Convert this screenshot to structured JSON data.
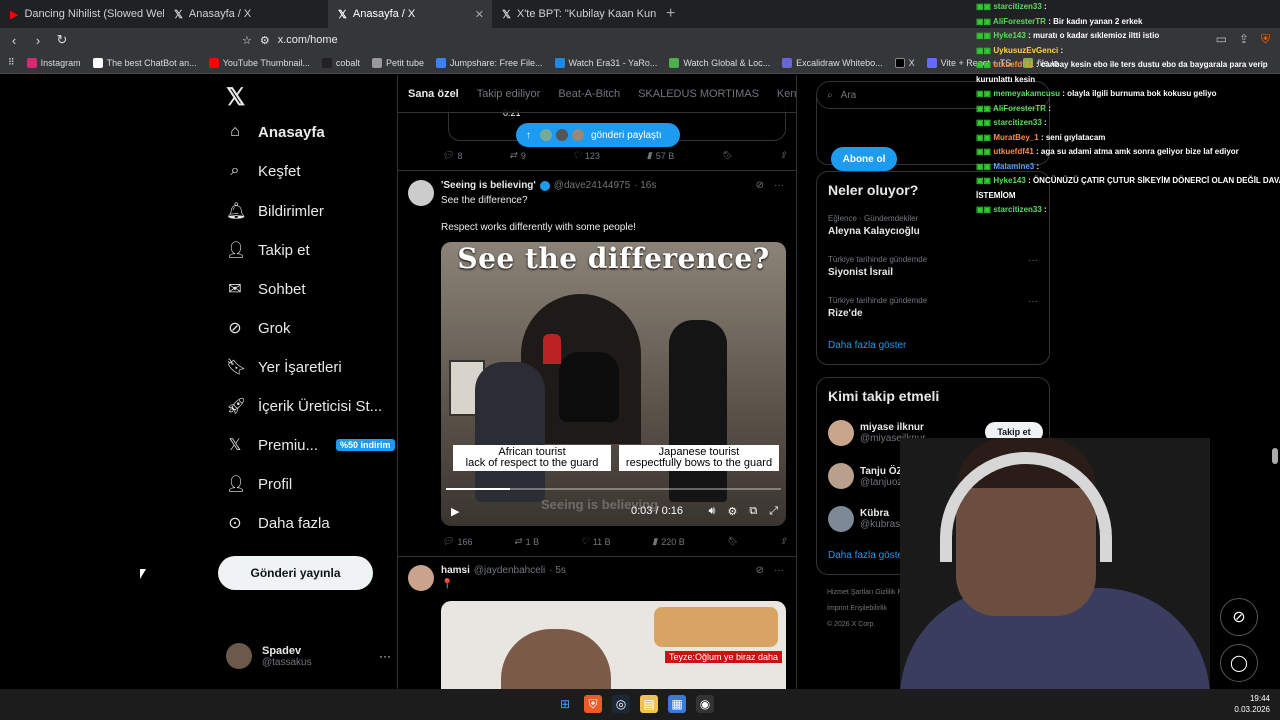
{
  "browser": {
    "tabs": [
      {
        "label": "Dancing Nihilist (Slowed Welly W",
        "active": false
      },
      {
        "label": "Anasayfa / X",
        "active": false
      },
      {
        "label": "Anasayfa / X",
        "active": true
      },
      {
        "label": "X'te BPT: \"Kubilay Kaan Kundakçı'nın",
        "active": false
      }
    ],
    "url": "x.com/home",
    "bookmarks": [
      "Instagram",
      "The best ChatBot an...",
      "YouTube Thumbnail...",
      "cobalt",
      "Petit tube",
      "Jumpshare: Free File...",
      "Watch Era31 - YaRo...",
      "Watch Global & Loc...",
      "Excalidraw Whitebo...",
      "X",
      "Vite + React + TS",
      "file.io"
    ],
    "bookmarks_trailing": "İşaretleri"
  },
  "nav": {
    "items": [
      {
        "label": "Anasayfa",
        "icon": "home-icon",
        "active": true
      },
      {
        "label": "Keşfet",
        "icon": "search-icon"
      },
      {
        "label": "Bildirimler",
        "icon": "bell-icon"
      },
      {
        "label": "Takip et",
        "icon": "person-add-icon"
      },
      {
        "label": "Sohbet",
        "icon": "mail-icon"
      },
      {
        "label": "Grok",
        "icon": "grok-icon"
      },
      {
        "label": "Yer İşaretleri",
        "icon": "bookmark-icon"
      },
      {
        "label": "İçerik Üreticisi St...",
        "icon": "rocket-icon"
      },
      {
        "label": "Premiu...",
        "icon": "x-icon",
        "badge": "%50 indirim"
      },
      {
        "label": "Profil",
        "icon": "profile-icon"
      },
      {
        "label": "Daha fazla",
        "icon": "more-circle-icon"
      }
    ],
    "post_button": "Gönderi yayınla",
    "account": {
      "name": "Spadev",
      "handle": "@tassakus"
    }
  },
  "feed": {
    "tabs": [
      "Sana özel",
      "Takip ediliyor",
      "Beat-A-Bitch",
      "SKALEDUS MORTIMAS",
      "Kend"
    ],
    "prev_media_time": "0:21",
    "share_pill": "gönderi paylaştı",
    "prev_actions": {
      "replies": "8",
      "reposts": "9",
      "likes": "123",
      "views": "57 B"
    },
    "tweet1": {
      "name": "'Seeing is believing'",
      "handle": "@dave24144975",
      "time": "· 16s",
      "text1": "See the difference?",
      "text2": "Respect works differently with some people!",
      "video": {
        "title": "See the difference?",
        "caption_left": "African tourist\nlack of respect to the guard",
        "caption_right": "Japanese tourist\nrespectfully bows to the guard",
        "ghost": "Seeing is believing",
        "time": "0:03 / 0:16",
        "progress": 0.19
      },
      "actions": {
        "replies": "166",
        "reposts": "1 B",
        "likes": "11 B",
        "views": "220 B"
      }
    },
    "tweet2": {
      "name": "hamsi",
      "handle": "@jaydenbahceli",
      "time": "· 5s",
      "text": "📍",
      "news_caption": "Teyze:Oğlum ye biraz daha"
    }
  },
  "right": {
    "search_placeholder": "Ara",
    "subscribe": "Abone ol",
    "happening_title": "Neler oluyor?",
    "trends": [
      {
        "context": "Eğlence · Gündemdekiler",
        "title": "Aleyna Kalaycıoğlu"
      },
      {
        "context": "Türkiye tarihinde gündemde",
        "title": "Siyonist İsrail"
      },
      {
        "context": "Türkiye tarihinde gündemde",
        "title": "Rize'de"
      }
    ],
    "show_more": "Daha fazla göster",
    "who_title": "Kimi takip etmeli",
    "who": [
      {
        "name": "miyase ilknur",
        "handle": "@miyaseilknur",
        "follow": "Takip et"
      },
      {
        "name": "Tanju ÖZCAN",
        "handle": "@tanjuozcanchp"
      },
      {
        "name": "Kübra",
        "handle": "@kubraskii"
      }
    ],
    "who_more": "Daha fazla göster",
    "footer": [
      "Hizmet Şartları   Gizlilik P...",
      "İmprint   Erişilebilirlik",
      "© 2026 X Corp."
    ]
  },
  "chat": [
    {
      "user": "starcitizen33",
      "msg": ":"
    },
    {
      "user": "AliForesterTR",
      "msg": ": Bir kadın yanan 2 erkek"
    },
    {
      "user": "Hyke143",
      "msg": ": muratı o kadar sıklemioz iltti istio"
    },
    {
      "user": "UykusuzEvGenci",
      "msg": ":"
    },
    {
      "user": "utkuefdf41",
      "msg": ": canbay kesin ebo ile ters dustu ebo da baygarala para verip"
    },
    {
      "user": "",
      "msg": "kurunlattı kesin"
    },
    {
      "user": "memeyakamcusu",
      "msg": ": olayla ilgili burnuma bok kokusu geliyo"
    },
    {
      "user": "AliForesterTR",
      "msg": ":"
    },
    {
      "user": "starcitizen33",
      "msg": ":"
    },
    {
      "user": "MuratBey_1",
      "msg": ": seni gıylatacam"
    },
    {
      "user": "utkuefdf41",
      "msg": ": aga su adami atma amk sonra geliyor bize laf ediyor"
    },
    {
      "user": "Malamine3",
      "msg": ":"
    },
    {
      "user": "Hyke143",
      "msg": ": ÖNCÜNÜZÜ ÇATIR ÇUTUR SİKEYİM DÖNERCİ OLAN DEĞİL DAVA"
    },
    {
      "user": "",
      "msg": "İSTEMİOM"
    },
    {
      "user": "starcitizen33",
      "msg": ":"
    }
  ],
  "taskbar": {
    "time": "19:44",
    "date": "0.03.2026"
  }
}
